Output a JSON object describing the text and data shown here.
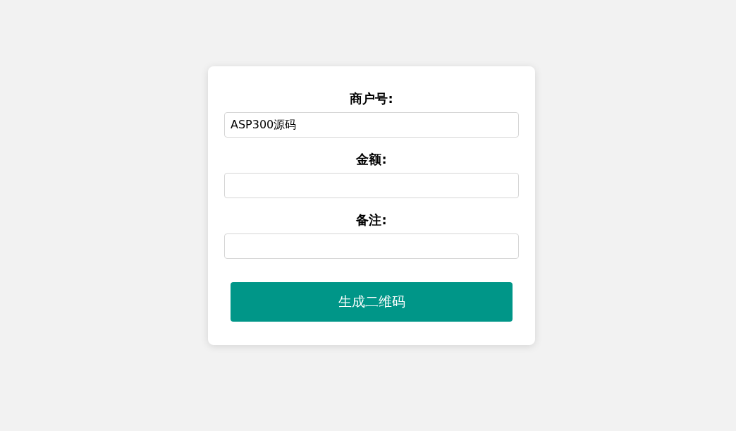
{
  "form": {
    "fields": [
      {
        "label": "商户号:",
        "value": "ASP300源码"
      },
      {
        "label": "金额:"
      },
      {
        "label": "备注:"
      }
    ],
    "submit_button": "生成二维码"
  }
}
